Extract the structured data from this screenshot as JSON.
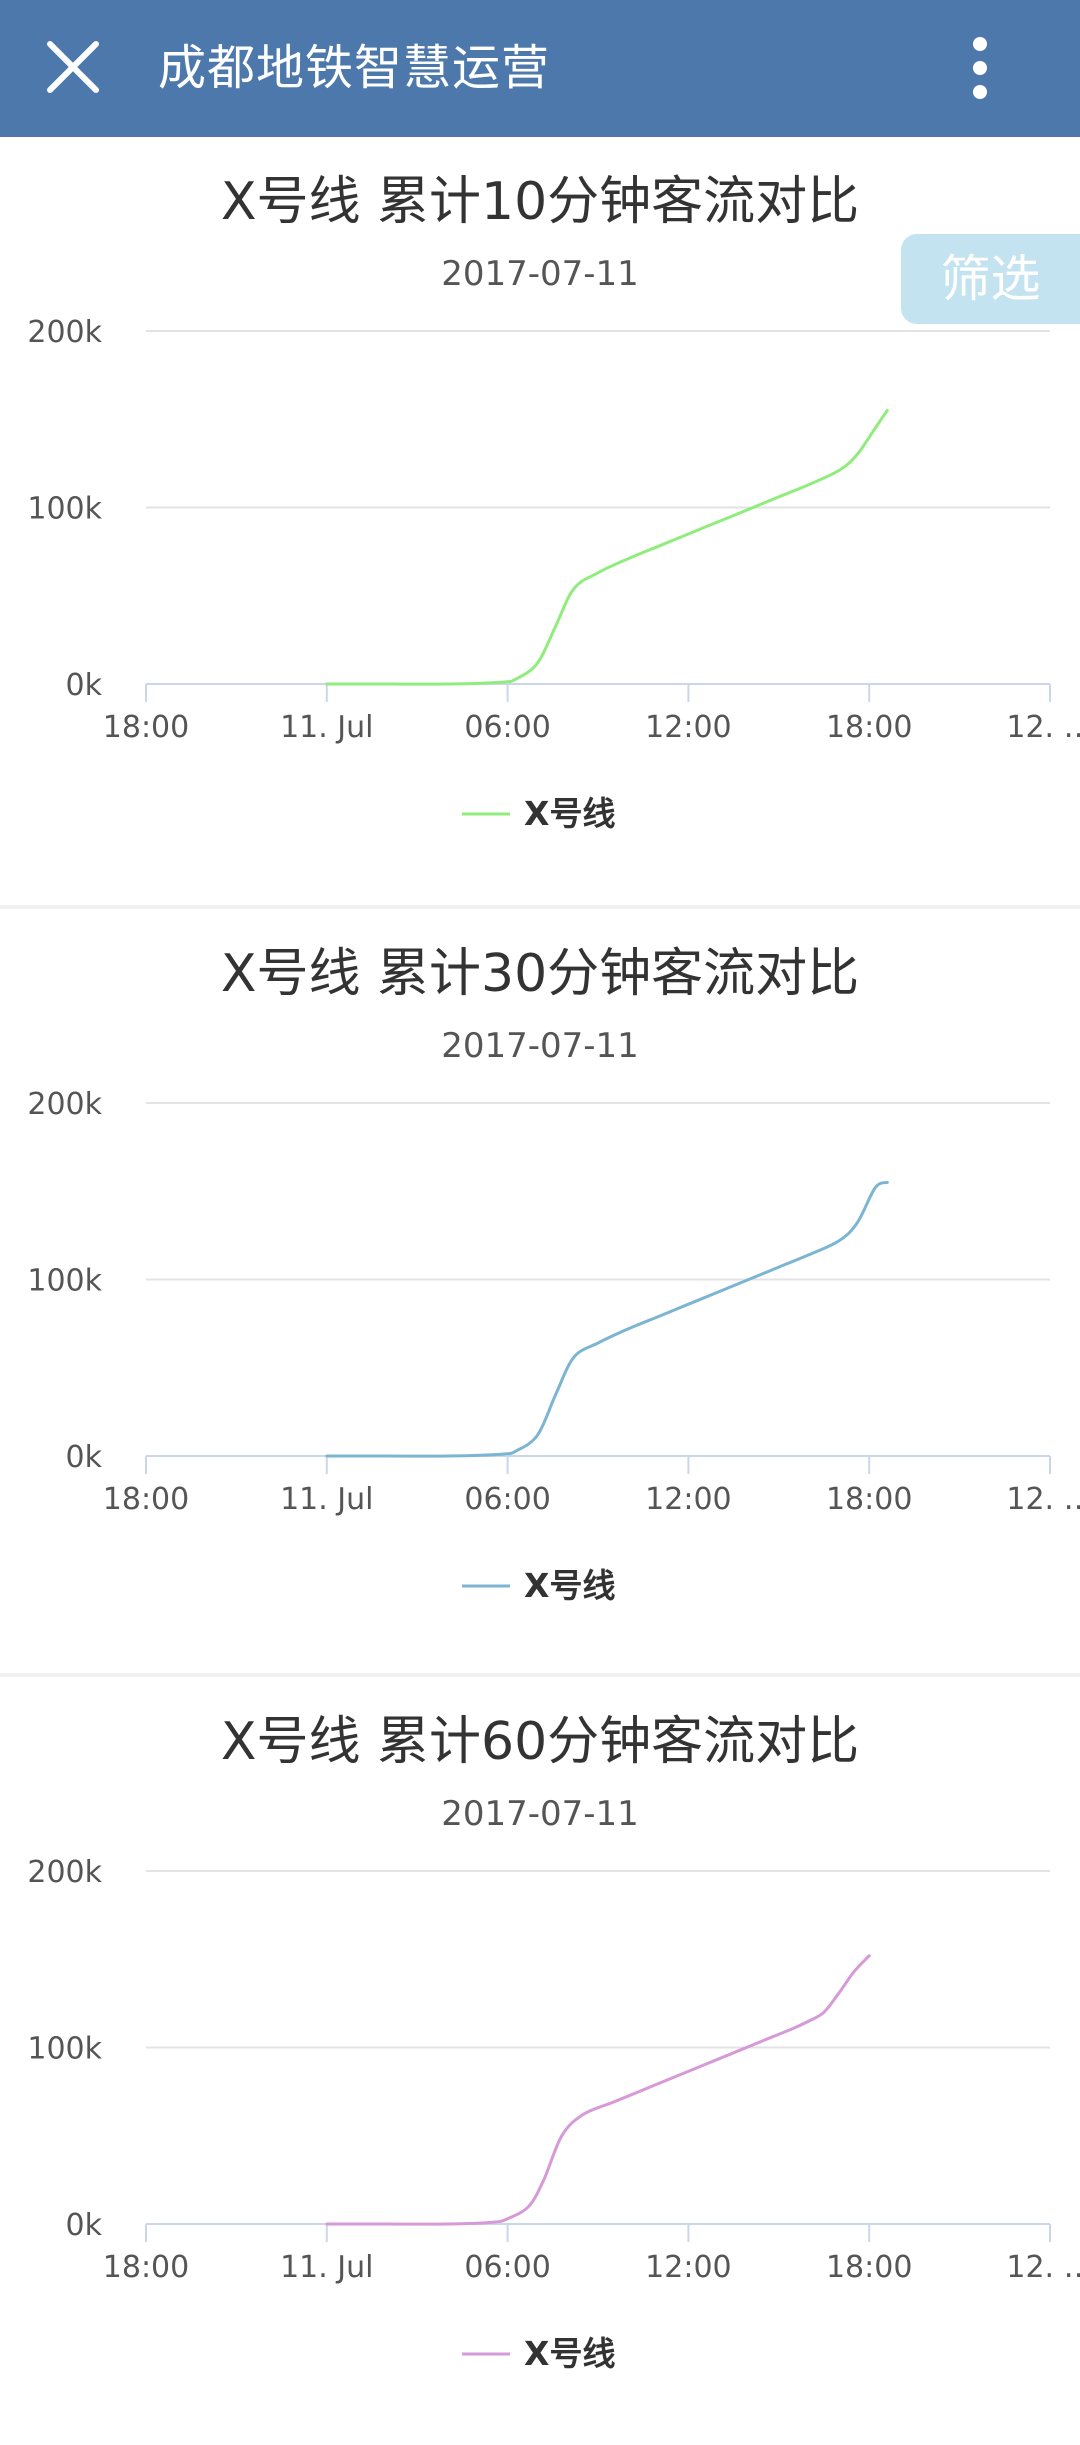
{
  "app": {
    "title": "成都地铁智慧运营",
    "close_icon": "close-icon",
    "menu_icon": "more-vert-icon",
    "header_color": "#4d78ab"
  },
  "filter": {
    "label": "筛选",
    "color": "#c4e3f1"
  },
  "chart_data": [
    {
      "type": "line",
      "title": "X号线 累计10分钟客流对比",
      "subtitle": "2017-07-11",
      "x_tick_labels": [
        "18:00",
        "11. Jul",
        "06:00",
        "12:00",
        "18:00",
        "12. …"
      ],
      "x_tick_hours": [
        -6,
        0,
        6,
        12,
        18,
        24
      ],
      "xlim_hours": [
        -6,
        24
      ],
      "y_tick_labels": [
        "200k",
        "100k",
        "0k"
      ],
      "y_tick_values": [
        200000,
        100000,
        0
      ],
      "ylim": [
        0,
        200000
      ],
      "grid": true,
      "legend_position": "bottom-center",
      "series": [
        {
          "name": "X号线",
          "color": "#90ed7d",
          "x": [
            0,
            2,
            4,
            5.8,
            6.3,
            7,
            7.6,
            8.2,
            9,
            10,
            11,
            12,
            13,
            14,
            15,
            16,
            17,
            17.6,
            18.2,
            18.6
          ],
          "y": [
            0,
            0,
            0,
            1000,
            3000,
            12000,
            33000,
            54000,
            63000,
            71000,
            78000,
            85000,
            92000,
            99000,
            106000,
            113000,
            121000,
            130000,
            145000,
            155000
          ]
        }
      ]
    },
    {
      "type": "line",
      "title": "X号线 累计30分钟客流对比",
      "subtitle": "2017-07-11",
      "x_tick_labels": [
        "18:00",
        "11. Jul",
        "06:00",
        "12:00",
        "18:00",
        "12. …"
      ],
      "x_tick_hours": [
        -6,
        0,
        6,
        12,
        18,
        24
      ],
      "xlim_hours": [
        -6,
        24
      ],
      "y_tick_labels": [
        "200k",
        "100k",
        "0k"
      ],
      "y_tick_values": [
        200000,
        100000,
        0
      ],
      "ylim": [
        0,
        200000
      ],
      "grid": true,
      "legend_position": "bottom-center",
      "series": [
        {
          "name": "X号线",
          "color": "#7cb5d2",
          "x": [
            0,
            2,
            4,
            5.8,
            6.3,
            7,
            7.6,
            8.2,
            9,
            10,
            11,
            12,
            13,
            14,
            15,
            16,
            17,
            17.6,
            18.2,
            18.6
          ],
          "y": [
            0,
            0,
            0,
            1000,
            3000,
            12000,
            35000,
            56000,
            64000,
            72000,
            79000,
            86000,
            93000,
            100000,
            107000,
            114000,
            122000,
            132000,
            152000,
            155000
          ]
        }
      ]
    },
    {
      "type": "line",
      "title": "X号线 累计60分钟客流对比",
      "subtitle": "2017-07-11",
      "x_tick_labels": [
        "18:00",
        "11. Jul",
        "06:00",
        "12:00",
        "18:00",
        "12. …"
      ],
      "x_tick_hours": [
        -6,
        0,
        6,
        12,
        18,
        24
      ],
      "xlim_hours": [
        -6,
        24
      ],
      "y_tick_labels": [
        "200k",
        "100k",
        "0k"
      ],
      "y_tick_values": [
        200000,
        100000,
        0
      ],
      "ylim": [
        0,
        200000
      ],
      "grid": true,
      "legend_position": "bottom-center",
      "series": [
        {
          "name": "X号线",
          "color": "#d69ad8",
          "x": [
            0,
            2,
            4,
            5.5,
            6,
            6.7,
            7.2,
            7.8,
            8.5,
            9.5,
            10.5,
            11.5,
            12.5,
            13.5,
            14.5,
            15.5,
            16,
            16.5,
            17,
            17.5,
            18
          ],
          "y": [
            0,
            0,
            0,
            1000,
            3000,
            10000,
            25000,
            50000,
            62000,
            69000,
            76000,
            83000,
            90000,
            97000,
            104000,
            111000,
            115000,
            120000,
            131000,
            143000,
            152000
          ]
        }
      ]
    }
  ]
}
